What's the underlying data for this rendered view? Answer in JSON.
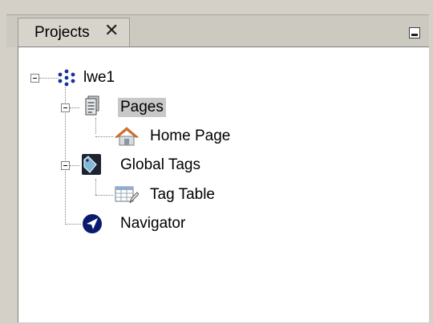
{
  "tab": {
    "label": "Projects",
    "close_glyph": "✕"
  },
  "tree": {
    "root": {
      "label": "lwe1",
      "icon": "project-network-icon"
    },
    "pages": {
      "label": "Pages",
      "icon": "pages-document-icon",
      "selected": true
    },
    "home_page": {
      "label": "Home Page",
      "icon": "home-icon"
    },
    "global_tags": {
      "label": "Global Tags",
      "icon": "tag-icon"
    },
    "tag_table": {
      "label": "Tag Table",
      "icon": "table-edit-icon"
    },
    "navigator": {
      "label": "Navigator",
      "icon": "navigator-arrow-icon"
    }
  },
  "colors": {
    "selection": "#c8c8c8",
    "home_roof": "#e8823a",
    "navigator": "#0a1a6e"
  }
}
